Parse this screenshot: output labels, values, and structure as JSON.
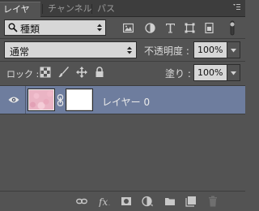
{
  "tabs": [
    {
      "label": "レイヤー",
      "active": true
    },
    {
      "label": "チャンネル",
      "active": false
    },
    {
      "label": "パス",
      "active": false
    }
  ],
  "filter": {
    "kind_label": "種類"
  },
  "blend": {
    "mode": "通常",
    "opacity_label": "不透明度 :",
    "opacity_value": "100%",
    "fill_label": "塗り :",
    "fill_value": "100%"
  },
  "lock": {
    "label": "ロック :"
  },
  "layers": [
    {
      "name": "レイヤー 0",
      "visible": true,
      "selected": true
    }
  ],
  "colors": {
    "selected_row": "#6e7d9e",
    "panel": "#535353"
  }
}
